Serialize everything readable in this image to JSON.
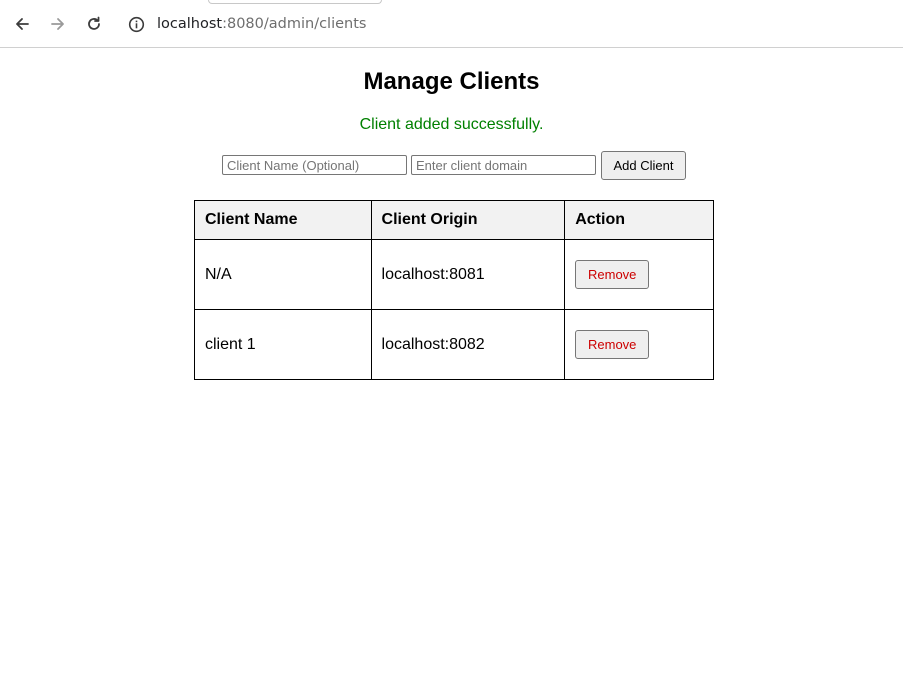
{
  "browser": {
    "url_host": "localhost",
    "url_path": ":8080/admin/clients"
  },
  "page": {
    "title": "Manage Clients",
    "flash_message": "Client added successfully.",
    "flash_color": "#008000"
  },
  "form": {
    "name_placeholder": "Client Name (Optional)",
    "name_value": "",
    "domain_placeholder": "Enter client domain",
    "domain_value": "",
    "submit_label": "Add Client"
  },
  "table": {
    "headers": [
      "Client Name",
      "Client Origin",
      "Action"
    ],
    "rows": [
      {
        "name": "N/A",
        "origin": "localhost:8081",
        "action_label": "Remove"
      },
      {
        "name": "client 1",
        "origin": "localhost:8082",
        "action_label": "Remove"
      }
    ],
    "action_color": "#cc0000"
  },
  "icons": {
    "back": "arrow-left-icon",
    "forward": "arrow-right-icon",
    "reload": "reload-icon",
    "site_info": "info-icon"
  }
}
